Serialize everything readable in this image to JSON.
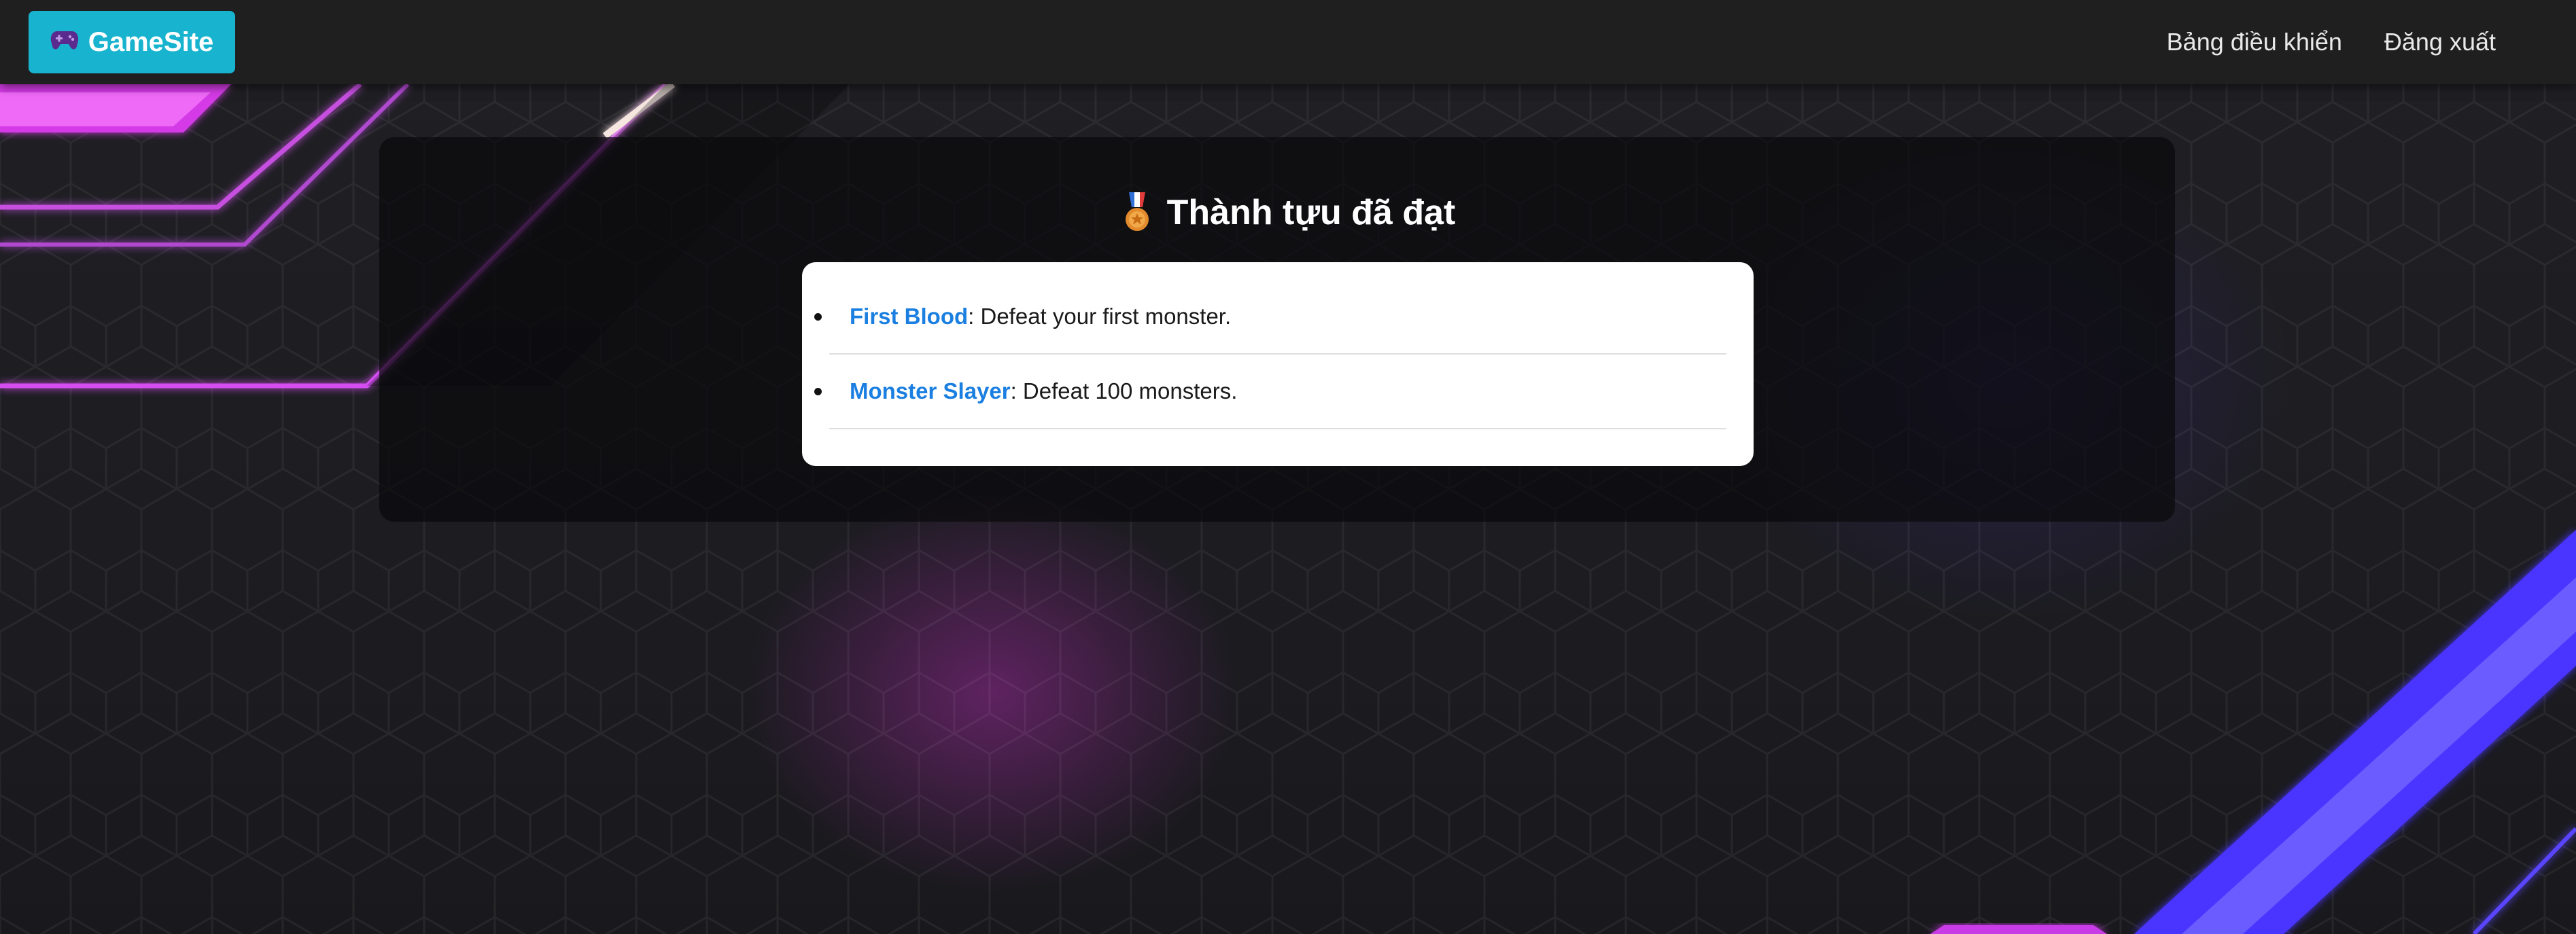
{
  "navbar": {
    "brand_label": "GameSite",
    "brand_icon": "gamepad-icon",
    "links": [
      {
        "label": "Bảng điều khiển"
      },
      {
        "label": "Đăng xuất"
      }
    ]
  },
  "main": {
    "title": "Thành tựu đã đạt",
    "title_icon": "medal-icon",
    "achievements": [
      {
        "name": "First Blood",
        "desc": ": Defeat your first monster."
      },
      {
        "name": "Monster Slayer",
        "desc": ": Defeat 100 monsters."
      }
    ]
  },
  "colors": {
    "brand": "#17b3cf",
    "navbar": "#1f1f1f",
    "link_accent": "#1a7fe0",
    "neon_pink": "#e04cf0",
    "neon_blue": "#4a3cff"
  }
}
